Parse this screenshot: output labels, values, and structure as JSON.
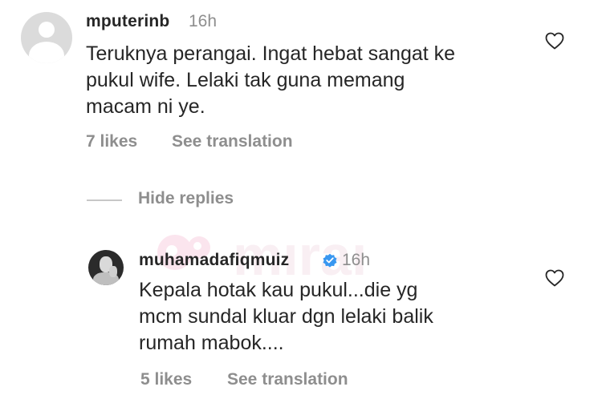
{
  "comments": [
    {
      "username": "mputerinb",
      "time": "16h",
      "text_lines": [
        "Teruknya perangai. Ingat hebat sangat ke",
        "pukul wife. Lelaki tak guna memang",
        "macam ni ye."
      ],
      "likes": "7 likes",
      "translate": "See translation"
    }
  ],
  "replies_toggle": "Hide replies",
  "reply": {
    "username": "muhamadafiqmuiz",
    "time": "16h",
    "text_lines": [
      "Kepala hotak kau pukul...die yg",
      "mcm sundal kluar dgn lelaki balik",
      "rumah mabok...."
    ],
    "likes": "5 likes",
    "translate": "See translation"
  },
  "watermark_text": "mıraı",
  "colors": {
    "text": "#262626",
    "secondary": "#8e8e8e",
    "verified": "#3897f0",
    "divider": "#c7c7c7"
  },
  "icons": [
    "default-avatar-icon",
    "heart-icon",
    "verified-badge-icon"
  ]
}
